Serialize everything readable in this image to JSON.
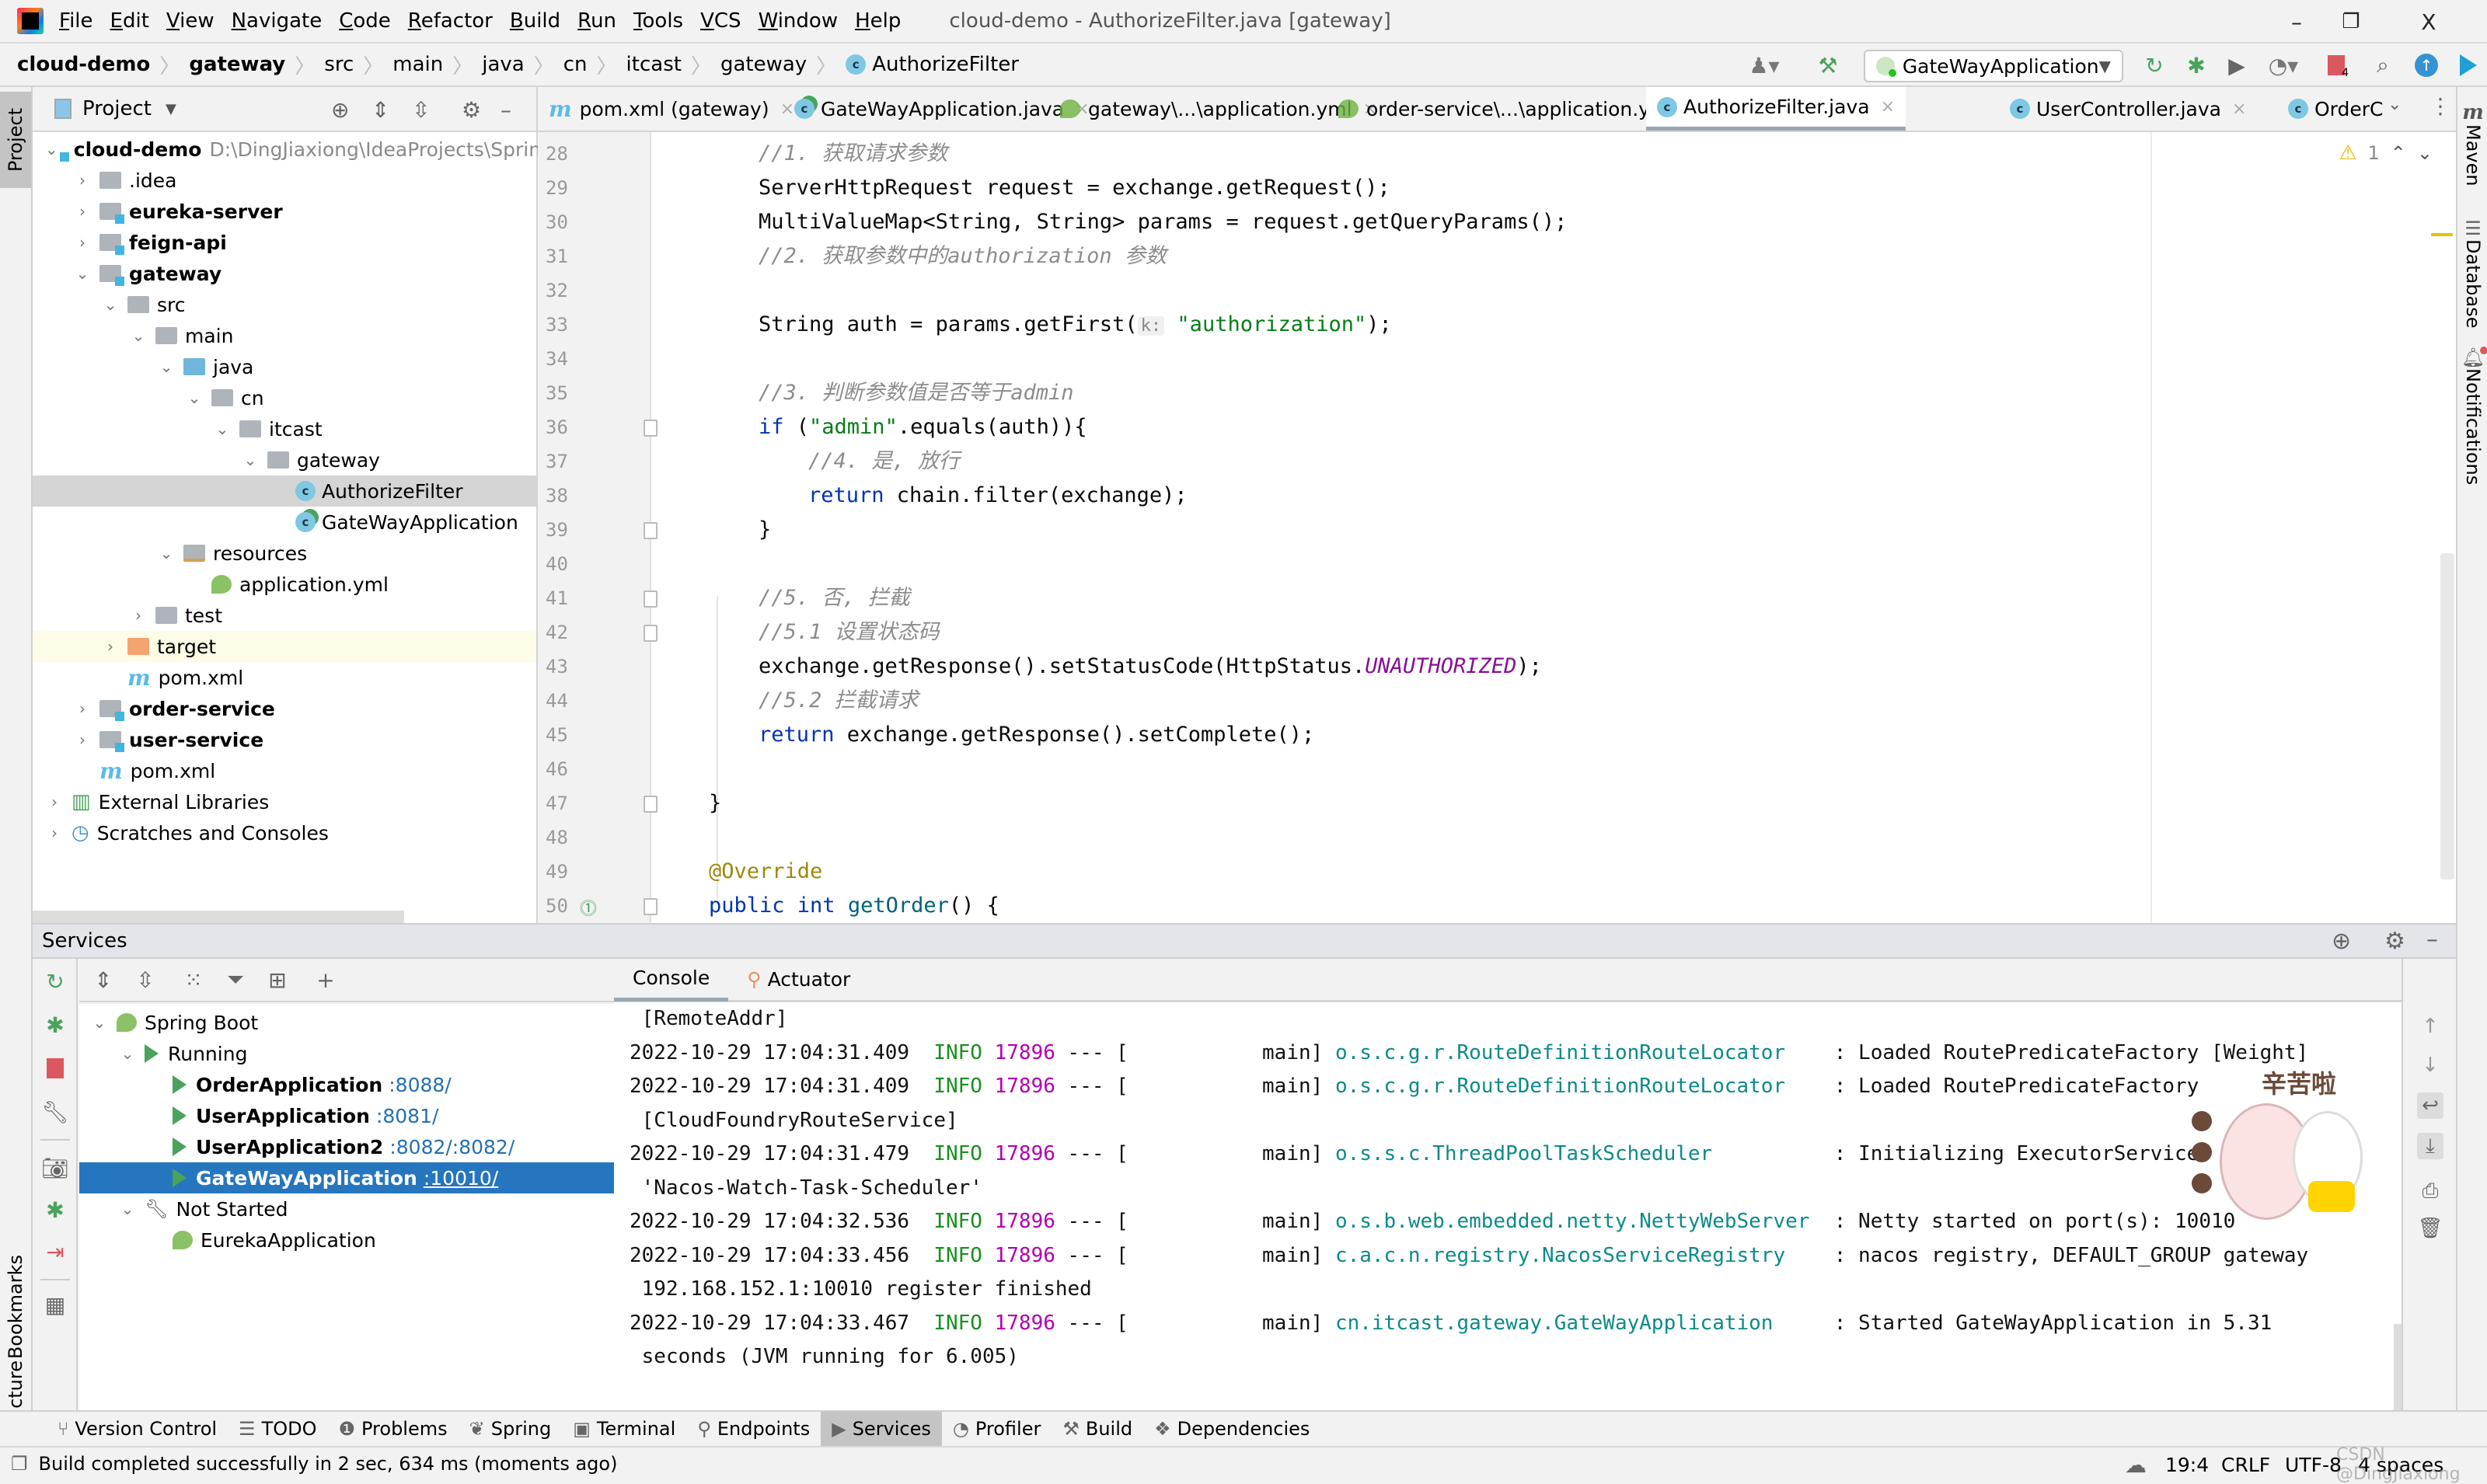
{
  "titlebar": {
    "menu": [
      "File",
      "Edit",
      "View",
      "Navigate",
      "Code",
      "Refactor",
      "Build",
      "Run",
      "Tools",
      "VCS",
      "Window",
      "Help"
    ],
    "window_title": "cloud-demo - AuthorizeFilter.java [gateway]",
    "minimize": "–",
    "restore": "❐",
    "close": "X"
  },
  "navbar": {
    "breadcrumbs": [
      "cloud-demo",
      "gateway",
      "src",
      "main",
      "java",
      "cn",
      "itcast",
      "gateway",
      "AuthorizeFilter"
    ],
    "run_config": "GateWayApplication",
    "stop_badge": "4"
  },
  "left_strip": {
    "project": "Project",
    "bookmarks": "Bookmarks",
    "structure": "Structure"
  },
  "right_strip": {
    "maven": "Maven",
    "database": "Database",
    "notifications": "Notifications"
  },
  "project_panel": {
    "title": "Project",
    "tree": [
      {
        "label": "cloud-demo",
        "extra": "D:\\DingJiaxiong\\IdeaProjects\\Sprin",
        "level": 0,
        "chev": "v",
        "icon": "module",
        "bold": true
      },
      {
        "label": ".idea",
        "level": 1,
        "chev": ">",
        "icon": "folder"
      },
      {
        "label": "eureka-server",
        "level": 1,
        "chev": ">",
        "icon": "module",
        "bold": true
      },
      {
        "label": "feign-api",
        "level": 1,
        "chev": ">",
        "icon": "module",
        "bold": true
      },
      {
        "label": "gateway",
        "level": 1,
        "chev": "v",
        "icon": "module",
        "bold": true
      },
      {
        "label": "src",
        "level": 2,
        "chev": "v",
        "icon": "folder"
      },
      {
        "label": "main",
        "level": 3,
        "chev": "v",
        "icon": "folder"
      },
      {
        "label": "java",
        "level": 4,
        "chev": "v",
        "icon": "folder-blue"
      },
      {
        "label": "cn",
        "level": 5,
        "chev": "v",
        "icon": "package"
      },
      {
        "label": "itcast",
        "level": 6,
        "chev": "v",
        "icon": "package"
      },
      {
        "label": "gateway",
        "level": 7,
        "chev": "v",
        "icon": "package"
      },
      {
        "label": "AuthorizeFilter",
        "level": 8,
        "chev": "",
        "icon": "class",
        "selected": true
      },
      {
        "label": "GateWayApplication",
        "level": 8,
        "chev": "",
        "icon": "class-spring"
      },
      {
        "label": "resources",
        "level": 4,
        "chev": "v",
        "icon": "folder-res"
      },
      {
        "label": "application.yml",
        "level": 5,
        "chev": "",
        "icon": "spring"
      },
      {
        "label": "test",
        "level": 3,
        "chev": ">",
        "icon": "folder"
      },
      {
        "label": "target",
        "level": 2,
        "chev": ">",
        "icon": "folder-orange",
        "highlight": true
      },
      {
        "label": "pom.xml",
        "level": 2,
        "chev": "",
        "icon": "maven"
      },
      {
        "label": "order-service",
        "level": 1,
        "chev": ">",
        "icon": "module",
        "bold": true
      },
      {
        "label": "user-service",
        "level": 1,
        "chev": ">",
        "icon": "module",
        "bold": true
      },
      {
        "label": "pom.xml",
        "level": 1,
        "chev": "",
        "icon": "maven"
      },
      {
        "label": "External Libraries",
        "level": 0,
        "chev": ">",
        "icon": "libraries"
      },
      {
        "label": "Scratches and Consoles",
        "level": 0,
        "chev": ">",
        "icon": "scratches"
      }
    ]
  },
  "editor": {
    "tabs": [
      {
        "label": "pom.xml (gateway)",
        "icon": "maven"
      },
      {
        "label": "GateWayApplication.java",
        "icon": "class-spring"
      },
      {
        "label": "gateway\\...\\application.yml",
        "icon": "spring"
      },
      {
        "label": "order-service\\...\\application.yml",
        "icon": "spring"
      },
      {
        "label": "AuthorizeFilter.java",
        "icon": "class",
        "active": true
      },
      {
        "label": "UserController.java",
        "icon": "class"
      },
      {
        "label": "OrderC",
        "icon": "class"
      }
    ],
    "inspection_count": "1",
    "lines": [
      {
        "n": "28",
        "indent": 1,
        "parts": [
          [
            "cm",
            "//1. 获取请求参数"
          ]
        ]
      },
      {
        "n": "29",
        "indent": 1,
        "parts": [
          [
            "",
            "ServerHttpRequest request = exchange.getRequest();"
          ]
        ]
      },
      {
        "n": "30",
        "indent": 1,
        "parts": [
          [
            "",
            "MultiValueMap<String, String> params = request.getQueryParams();"
          ]
        ]
      },
      {
        "n": "31",
        "indent": 1,
        "parts": [
          [
            "cm",
            "//2. 获取参数中的authorization 参数"
          ]
        ]
      },
      {
        "n": "32",
        "indent": 1,
        "parts": []
      },
      {
        "n": "33",
        "indent": 1,
        "parts": [
          [
            "",
            "String auth = params.getFirst("
          ],
          [
            "hint",
            "k:"
          ],
          [
            "str",
            " \"authorization\""
          ],
          [
            "",
            ");"
          ]
        ]
      },
      {
        "n": "34",
        "indent": 1,
        "parts": []
      },
      {
        "n": "35",
        "indent": 1,
        "parts": [
          [
            "cm",
            "//3. 判断参数值是否等于admin"
          ]
        ]
      },
      {
        "n": "36",
        "indent": 1,
        "parts": [
          [
            "kw",
            "if"
          ],
          [
            "",
            " ("
          ],
          [
            "str",
            "\"admin\""
          ],
          [
            "",
            ".equals(auth)){"
          ]
        ]
      },
      {
        "n": "37",
        "indent": 2,
        "parts": [
          [
            "cm",
            "//4. 是, 放行"
          ]
        ]
      },
      {
        "n": "38",
        "indent": 2,
        "parts": [
          [
            "kw",
            "return"
          ],
          [
            "",
            " chain.filter(exchange);"
          ]
        ]
      },
      {
        "n": "39",
        "indent": 1,
        "parts": [
          [
            "",
            "}"
          ]
        ]
      },
      {
        "n": "40",
        "indent": 1,
        "parts": []
      },
      {
        "n": "41",
        "indent": 1,
        "parts": [
          [
            "cm",
            "//5. 否, 拦截"
          ]
        ]
      },
      {
        "n": "42",
        "indent": 1,
        "parts": [
          [
            "cm",
            "//5.1 设置状态码"
          ]
        ]
      },
      {
        "n": "43",
        "indent": 1,
        "parts": [
          [
            "",
            "exchange.getResponse().setStatusCode(HttpStatus."
          ],
          [
            "cst",
            "UNAUTHORIZED"
          ],
          [
            "",
            ");"
          ]
        ]
      },
      {
        "n": "44",
        "indent": 1,
        "parts": [
          [
            "cm",
            "//5.2 拦截请求"
          ]
        ]
      },
      {
        "n": "45",
        "indent": 1,
        "parts": [
          [
            "kw",
            "return"
          ],
          [
            "",
            " exchange.getResponse().setComplete();"
          ]
        ]
      },
      {
        "n": "46",
        "indent": 1,
        "parts": []
      },
      {
        "n": "47",
        "indent": 0,
        "parts": [
          [
            "",
            "}"
          ]
        ]
      },
      {
        "n": "48",
        "indent": 0,
        "parts": []
      },
      {
        "n": "49",
        "indent": 0,
        "parts": [
          [
            "ann",
            "@Override"
          ]
        ]
      },
      {
        "n": "50",
        "indent": 0,
        "parts": [
          [
            "kw",
            "public int"
          ],
          [
            "",
            " "
          ],
          [
            "fn",
            "getOrder"
          ],
          [
            "",
            "() {"
          ]
        ]
      }
    ],
    "fold_markers": [
      "36",
      "39",
      "41",
      "42",
      "47",
      "50"
    ]
  },
  "services": {
    "title": "Services",
    "tree": [
      {
        "label": "Spring Boot",
        "level": 0,
        "chev": "v",
        "icon": "spring"
      },
      {
        "label": "Running",
        "level": 1,
        "chev": "v",
        "icon": "play"
      },
      {
        "label": "OrderApplication",
        "port": ":8088/",
        "level": 2,
        "icon": "play",
        "bold": true
      },
      {
        "label": "UserApplication",
        "port": ":8081/",
        "level": 2,
        "icon": "play",
        "bold": true
      },
      {
        "label": "UserApplication2",
        "port": " :8082/:8082/",
        "level": 2,
        "icon": "play",
        "bold": true
      },
      {
        "label": "GateWayApplication",
        "port": ":10010/",
        "level": 2,
        "icon": "play",
        "bold": true,
        "selected": true
      },
      {
        "label": "Not Started",
        "level": 1,
        "chev": "v",
        "icon": "wrench"
      },
      {
        "label": "EurekaApplication",
        "level": 2,
        "icon": "spring"
      }
    ],
    "console_tabs": [
      "Console",
      "Actuator"
    ],
    "console_lines": [
      {
        "cont": " [RemoteAddr]"
      },
      {
        "ts": "2022-10-29 17:04:31.409",
        "lvl": "INFO",
        "pid": "17896",
        "thread": " --- [           main]",
        "logger": "o.s.c.g.r.RouteDefinitionRouteLocator   ",
        "msg": " : Loaded RoutePredicateFactory [Weight]"
      },
      {
        "ts": "2022-10-29 17:04:31.409",
        "lvl": "INFO",
        "pid": "17896",
        "thread": " --- [           main]",
        "logger": "o.s.c.g.r.RouteDefinitionRouteLocator   ",
        "msg": " : Loaded RoutePredicateFactory"
      },
      {
        "cont": " [CloudFoundryRouteService]"
      },
      {
        "ts": "2022-10-29 17:04:31.479",
        "lvl": "INFO",
        "pid": "17896",
        "thread": " --- [           main]",
        "logger": "o.s.s.c.ThreadPoolTaskScheduler         ",
        "msg": " : Initializing ExecutorService"
      },
      {
        "cont": " 'Nacos-Watch-Task-Scheduler'"
      },
      {
        "ts": "2022-10-29 17:04:32.536",
        "lvl": "INFO",
        "pid": "17896",
        "thread": " --- [           main]",
        "logger": "o.s.b.web.embedded.netty.NettyWebServer ",
        "msg": " : Netty started on port(s): 10010"
      },
      {
        "ts": "2022-10-29 17:04:33.456",
        "lvl": "INFO",
        "pid": "17896",
        "thread": " --- [           main]",
        "logger": "c.a.c.n.registry.NacosServiceRegistry   ",
        "msg": " : nacos registry, DEFAULT_GROUP gateway"
      },
      {
        "cont": " 192.168.152.1:10010 register finished"
      },
      {
        "ts": "2022-10-29 17:04:33.467",
        "lvl": "INFO",
        "pid": "17896",
        "thread": " --- [           main]",
        "logger": "cn.itcast.gateway.GateWayApplication    ",
        "msg": " : Started GateWayApplication in 5.31"
      },
      {
        "cont": " seconds (JVM running for 6.005)"
      }
    ],
    "sticker_text": "辛苦啦"
  },
  "tool_windows": [
    {
      "label": "Version Control",
      "icon": "vcs-icon"
    },
    {
      "label": "TODO",
      "icon": "todo-icon"
    },
    {
      "label": "Problems",
      "icon": "problems-icon"
    },
    {
      "label": "Spring",
      "icon": "spring-icon"
    },
    {
      "label": "Terminal",
      "icon": "terminal-icon"
    },
    {
      "label": "Endpoints",
      "icon": "endpoints-icon"
    },
    {
      "label": "Services",
      "icon": "services-icon",
      "active": true
    },
    {
      "label": "Profiler",
      "icon": "profiler-icon"
    },
    {
      "label": "Build",
      "icon": "build-icon"
    },
    {
      "label": "Dependencies",
      "icon": "dependencies-icon"
    }
  ],
  "statusbar": {
    "message": "Build completed successfully in 2 sec, 634 ms (moments ago)",
    "position": "19:4",
    "line_ending": "CRLF",
    "encoding": "UTF-8",
    "indent": "4 spaces",
    "watermark": "CSDN @DingJiaxiong"
  }
}
